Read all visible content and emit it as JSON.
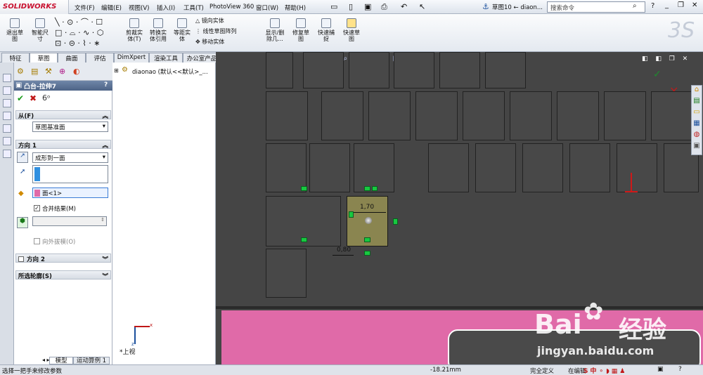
{
  "app": {
    "logo": "SOLIDWORKS",
    "doc_title": "草图10 ← diaon...",
    "search_placeholder": "搜索命令"
  },
  "menu": [
    "文件(F)",
    "编辑(E)",
    "视图(V)",
    "插入(I)",
    "工具(T)",
    "PhotoView 360",
    "窗口(W)",
    "帮助(H)"
  ],
  "toolbar": {
    "exit_sketch": "退出草\n图",
    "smart_dim": "智能尺\n寸",
    "trim": "剪裁实\n体(T)",
    "convert": "转换实\n体引用",
    "offset": "等距实\n体",
    "mirror": "镜向实体",
    "linear_pattern": "线性草图阵列",
    "move": "移动实体",
    "display_delete": "显示/删\n除几...",
    "repair": "修复草\n图",
    "quick_snap": "快速捕\n捉",
    "rapid_sketch": "快速草\n图"
  },
  "tabs": [
    "特征",
    "草图",
    "曲面",
    "评估",
    "DimXpert",
    "渲染工具",
    "办公室产品"
  ],
  "active_tab": "草图",
  "property_manager": {
    "title": "凸台-拉伸7",
    "from_label": "从(F)",
    "from_value": "草图基准面",
    "dir1_label": "方向 1",
    "dir1_type": "成形到一面",
    "face_value": "面<1>",
    "merge_label": "合并结果(M)",
    "merge_checked": true,
    "draft_label": "向外拔模(O)",
    "dir2_label": "方向 2",
    "contours_label": "所选轮廓(S)"
  },
  "tree": {
    "root": "diaonao  (默认<<默认>_..."
  },
  "bottom_tabs": [
    "模型",
    "运动算例 1"
  ],
  "viewport": {
    "dim1": "1,70",
    "dim2": "0,80",
    "view_label": "*上视"
  },
  "status": {
    "left": "选择一把手来修改参数",
    "coord": "-18.21mm",
    "state": "完全定义",
    "edit": "在编辑"
  },
  "watermark": {
    "brand": "Bai",
    "brand2": "经验",
    "url": "jingyan.baidu.com"
  },
  "colors": {
    "accent_green": "#18c840",
    "viewport_bg": "#454545",
    "pink": "#e06aa8"
  }
}
